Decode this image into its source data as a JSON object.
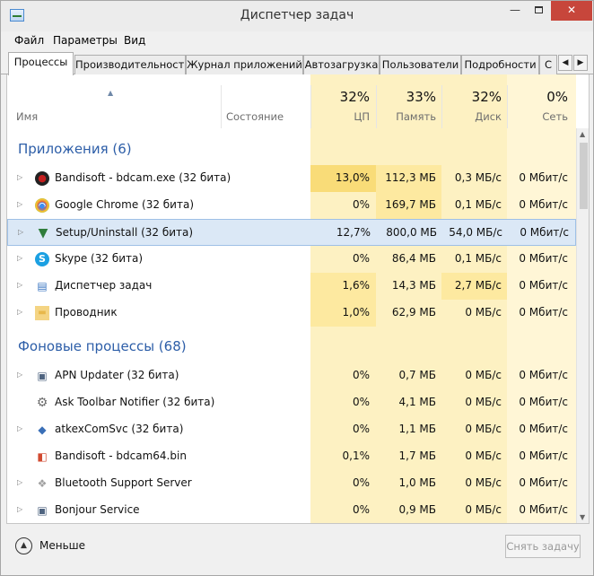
{
  "window": {
    "title": "Диспетчер задач"
  },
  "menu": [
    "Файл",
    "Параметры",
    "Вид"
  ],
  "tabs": [
    "Процессы",
    "Производительность",
    "Журнал приложений",
    "Автозагрузка",
    "Пользователи",
    "Подробности",
    "С"
  ],
  "columns": {
    "name": "Имя",
    "status": "Состояние",
    "cpu": {
      "pct": "32%",
      "label": "ЦП"
    },
    "memory": {
      "pct": "33%",
      "label": "Память"
    },
    "disk": {
      "pct": "32%",
      "label": "Диск"
    },
    "network": {
      "pct": "0%",
      "label": "Сеть"
    }
  },
  "groups": {
    "apps": "Приложения (6)",
    "background": "Фоновые процессы (68)"
  },
  "apps": [
    {
      "name": "Bandisoft - bdcam.exe (32 бита)",
      "icon": "bandicam-icon",
      "cpu": "13,0%",
      "mem": "112,3 МБ",
      "disk": "0,3 МБ/с",
      "net": "0 Мбит/с"
    },
    {
      "name": "Google Chrome (32 бита)",
      "icon": "chrome-icon",
      "cpu": "0%",
      "mem": "169,7 МБ",
      "disk": "0,1 МБ/с",
      "net": "0 Мбит/с"
    },
    {
      "name": "Setup/Uninstall (32 бита)",
      "icon": "setup-icon",
      "cpu": "12,7%",
      "mem": "800,0 МБ",
      "disk": "54,0 МБ/с",
      "net": "0 Мбит/с"
    },
    {
      "name": "Skype (32 бита)",
      "icon": "skype-icon",
      "cpu": "0%",
      "mem": "86,4 МБ",
      "disk": "0,1 МБ/с",
      "net": "0 Мбит/с"
    },
    {
      "name": "Диспетчер задач",
      "icon": "task-manager-icon",
      "cpu": "1,6%",
      "mem": "14,3 МБ",
      "disk": "2,7 МБ/с",
      "net": "0 Мбит/с"
    },
    {
      "name": "Проводник",
      "icon": "explorer-icon",
      "cpu": "1,0%",
      "mem": "62,9 МБ",
      "disk": "0 МБ/с",
      "net": "0 Мбит/с"
    }
  ],
  "background": [
    {
      "name": "APN Updater (32 бита)",
      "icon": "window-icon",
      "cpu": "0%",
      "mem": "0,7 МБ",
      "disk": "0 МБ/с",
      "net": "0 Мбит/с"
    },
    {
      "name": "Ask Toolbar Notifier (32 бита)",
      "icon": "gear-icon",
      "cpu": "0%",
      "mem": "4,1 МБ",
      "disk": "0 МБ/с",
      "net": "0 Мбит/с"
    },
    {
      "name": "atkexComSvc (32 бита)",
      "icon": "service-icon",
      "cpu": "0%",
      "mem": "1,1 МБ",
      "disk": "0 МБ/с",
      "net": "0 Мбит/с"
    },
    {
      "name": "Bandisoft - bdcam64.bin",
      "icon": "bdcam64-icon",
      "cpu": "0,1%",
      "mem": "1,7 МБ",
      "disk": "0 МБ/с",
      "net": "0 Мбит/с"
    },
    {
      "name": "Bluetooth Support Server",
      "icon": "bluetooth-icon",
      "cpu": "0%",
      "mem": "1,0 МБ",
      "disk": "0 МБ/с",
      "net": "0 Мбит/с"
    },
    {
      "name": "Bonjour Service",
      "icon": "window-icon",
      "cpu": "0%",
      "mem": "0,9 МБ",
      "disk": "0 МБ/с",
      "net": "0 Мбит/с"
    }
  ],
  "footer": {
    "less": "Меньше",
    "end_task": "Снять задачу"
  },
  "colors": {
    "group": "#2d5ea8",
    "selected": "#dbe8f6",
    "heat_light": "#fff4c4",
    "heat_mid": "#fde9a0",
    "heat_strong": "#f9dc78"
  }
}
